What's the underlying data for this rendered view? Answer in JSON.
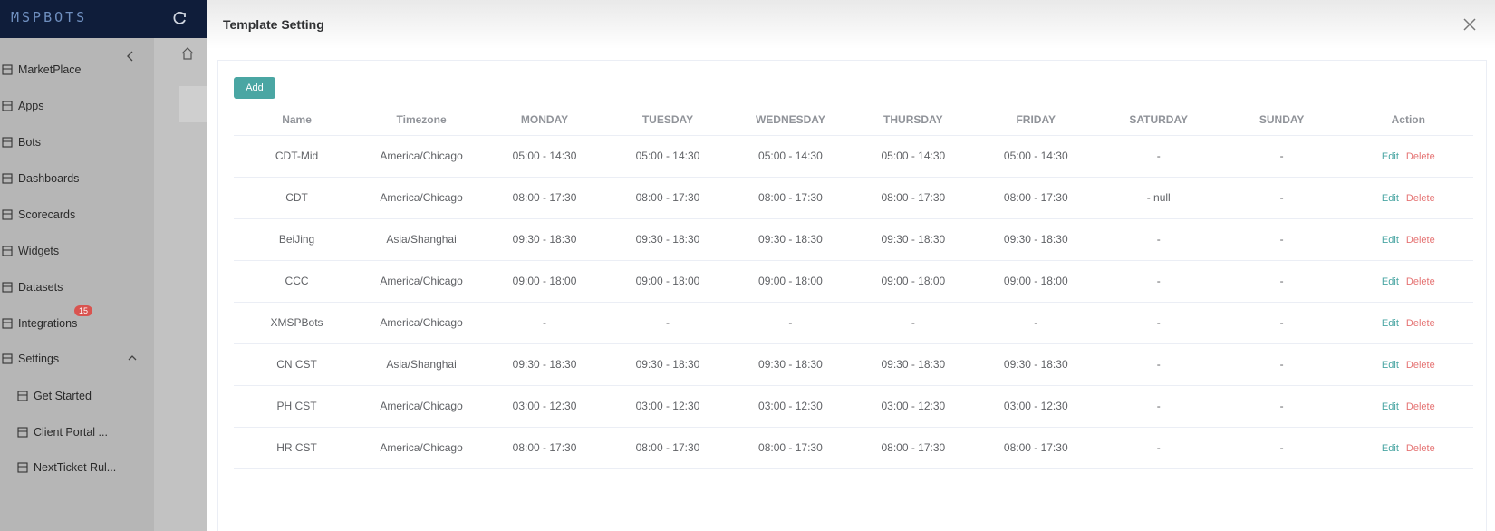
{
  "app": {
    "logo_text": "MSPBOTS"
  },
  "sidebar": {
    "items": [
      {
        "label": "MarketPlace",
        "icon": "store-icon"
      },
      {
        "label": "Apps",
        "icon": "apps-icon"
      },
      {
        "label": "Bots",
        "icon": "bot-icon"
      },
      {
        "label": "Dashboards",
        "icon": "dashboard-icon"
      },
      {
        "label": "Scorecards",
        "icon": "scorecard-icon"
      },
      {
        "label": "Widgets",
        "icon": "widget-icon"
      },
      {
        "label": "Datasets",
        "icon": "dataset-icon"
      },
      {
        "label": "Integrations",
        "icon": "integration-icon",
        "badge": "15"
      },
      {
        "label": "Settings",
        "icon": "gear-icon"
      },
      {
        "label": "Get Started",
        "icon": "get-started-icon"
      },
      {
        "label": "Client Portal ...",
        "icon": "shield-icon"
      },
      {
        "label": "NextTicket Rul...",
        "icon": "ticket-rule-icon"
      }
    ]
  },
  "drawer": {
    "title": "Template Setting",
    "add_label": "Add",
    "columns": [
      "Name",
      "Timezone",
      "MONDAY",
      "TUESDAY",
      "WEDNESDAY",
      "THURSDAY",
      "FRIDAY",
      "SATURDAY",
      "SUNDAY",
      "Action"
    ],
    "edit_label": "Edit",
    "delete_label": "Delete",
    "rows": [
      [
        "CDT-Mid",
        "America/Chicago",
        "05:00 - 14:30",
        "05:00 - 14:30",
        "05:00 - 14:30",
        "05:00 - 14:30",
        "05:00 - 14:30",
        "-",
        "-"
      ],
      [
        "CDT",
        "America/Chicago",
        "08:00 - 17:30",
        "08:00 - 17:30",
        "08:00 - 17:30",
        "08:00 - 17:30",
        "08:00 - 17:30",
        "- null",
        "-"
      ],
      [
        "BeiJing",
        "Asia/Shanghai",
        "09:30 - 18:30",
        "09:30 - 18:30",
        "09:30 - 18:30",
        "09:30 - 18:30",
        "09:30 - 18:30",
        "-",
        "-"
      ],
      [
        "CCC",
        "America/Chicago",
        "09:00 - 18:00",
        "09:00 - 18:00",
        "09:00 - 18:00",
        "09:00 - 18:00",
        "09:00 - 18:00",
        "-",
        "-"
      ],
      [
        "XMSPBots",
        "America/Chicago",
        "-",
        "-",
        "-",
        "-",
        "-",
        "-",
        "-"
      ],
      [
        "CN CST",
        "Asia/Shanghai",
        "09:30 - 18:30",
        "09:30 - 18:30",
        "09:30 - 18:30",
        "09:30 - 18:30",
        "09:30 - 18:30",
        "-",
        "-"
      ],
      [
        "PH CST",
        "America/Chicago",
        "03:00 - 12:30",
        "03:00 - 12:30",
        "03:00 - 12:30",
        "03:00 - 12:30",
        "03:00 - 12:30",
        "-",
        "-"
      ],
      [
        "HR CST",
        "America/Chicago",
        "08:00 - 17:30",
        "08:00 - 17:30",
        "08:00 - 17:30",
        "08:00 - 17:30",
        "08:00 - 17:30",
        "-",
        "-"
      ]
    ]
  },
  "colors": {
    "accent": "#4aa6a3",
    "delete": "#e57373",
    "topbar": "#0f1d3a"
  }
}
